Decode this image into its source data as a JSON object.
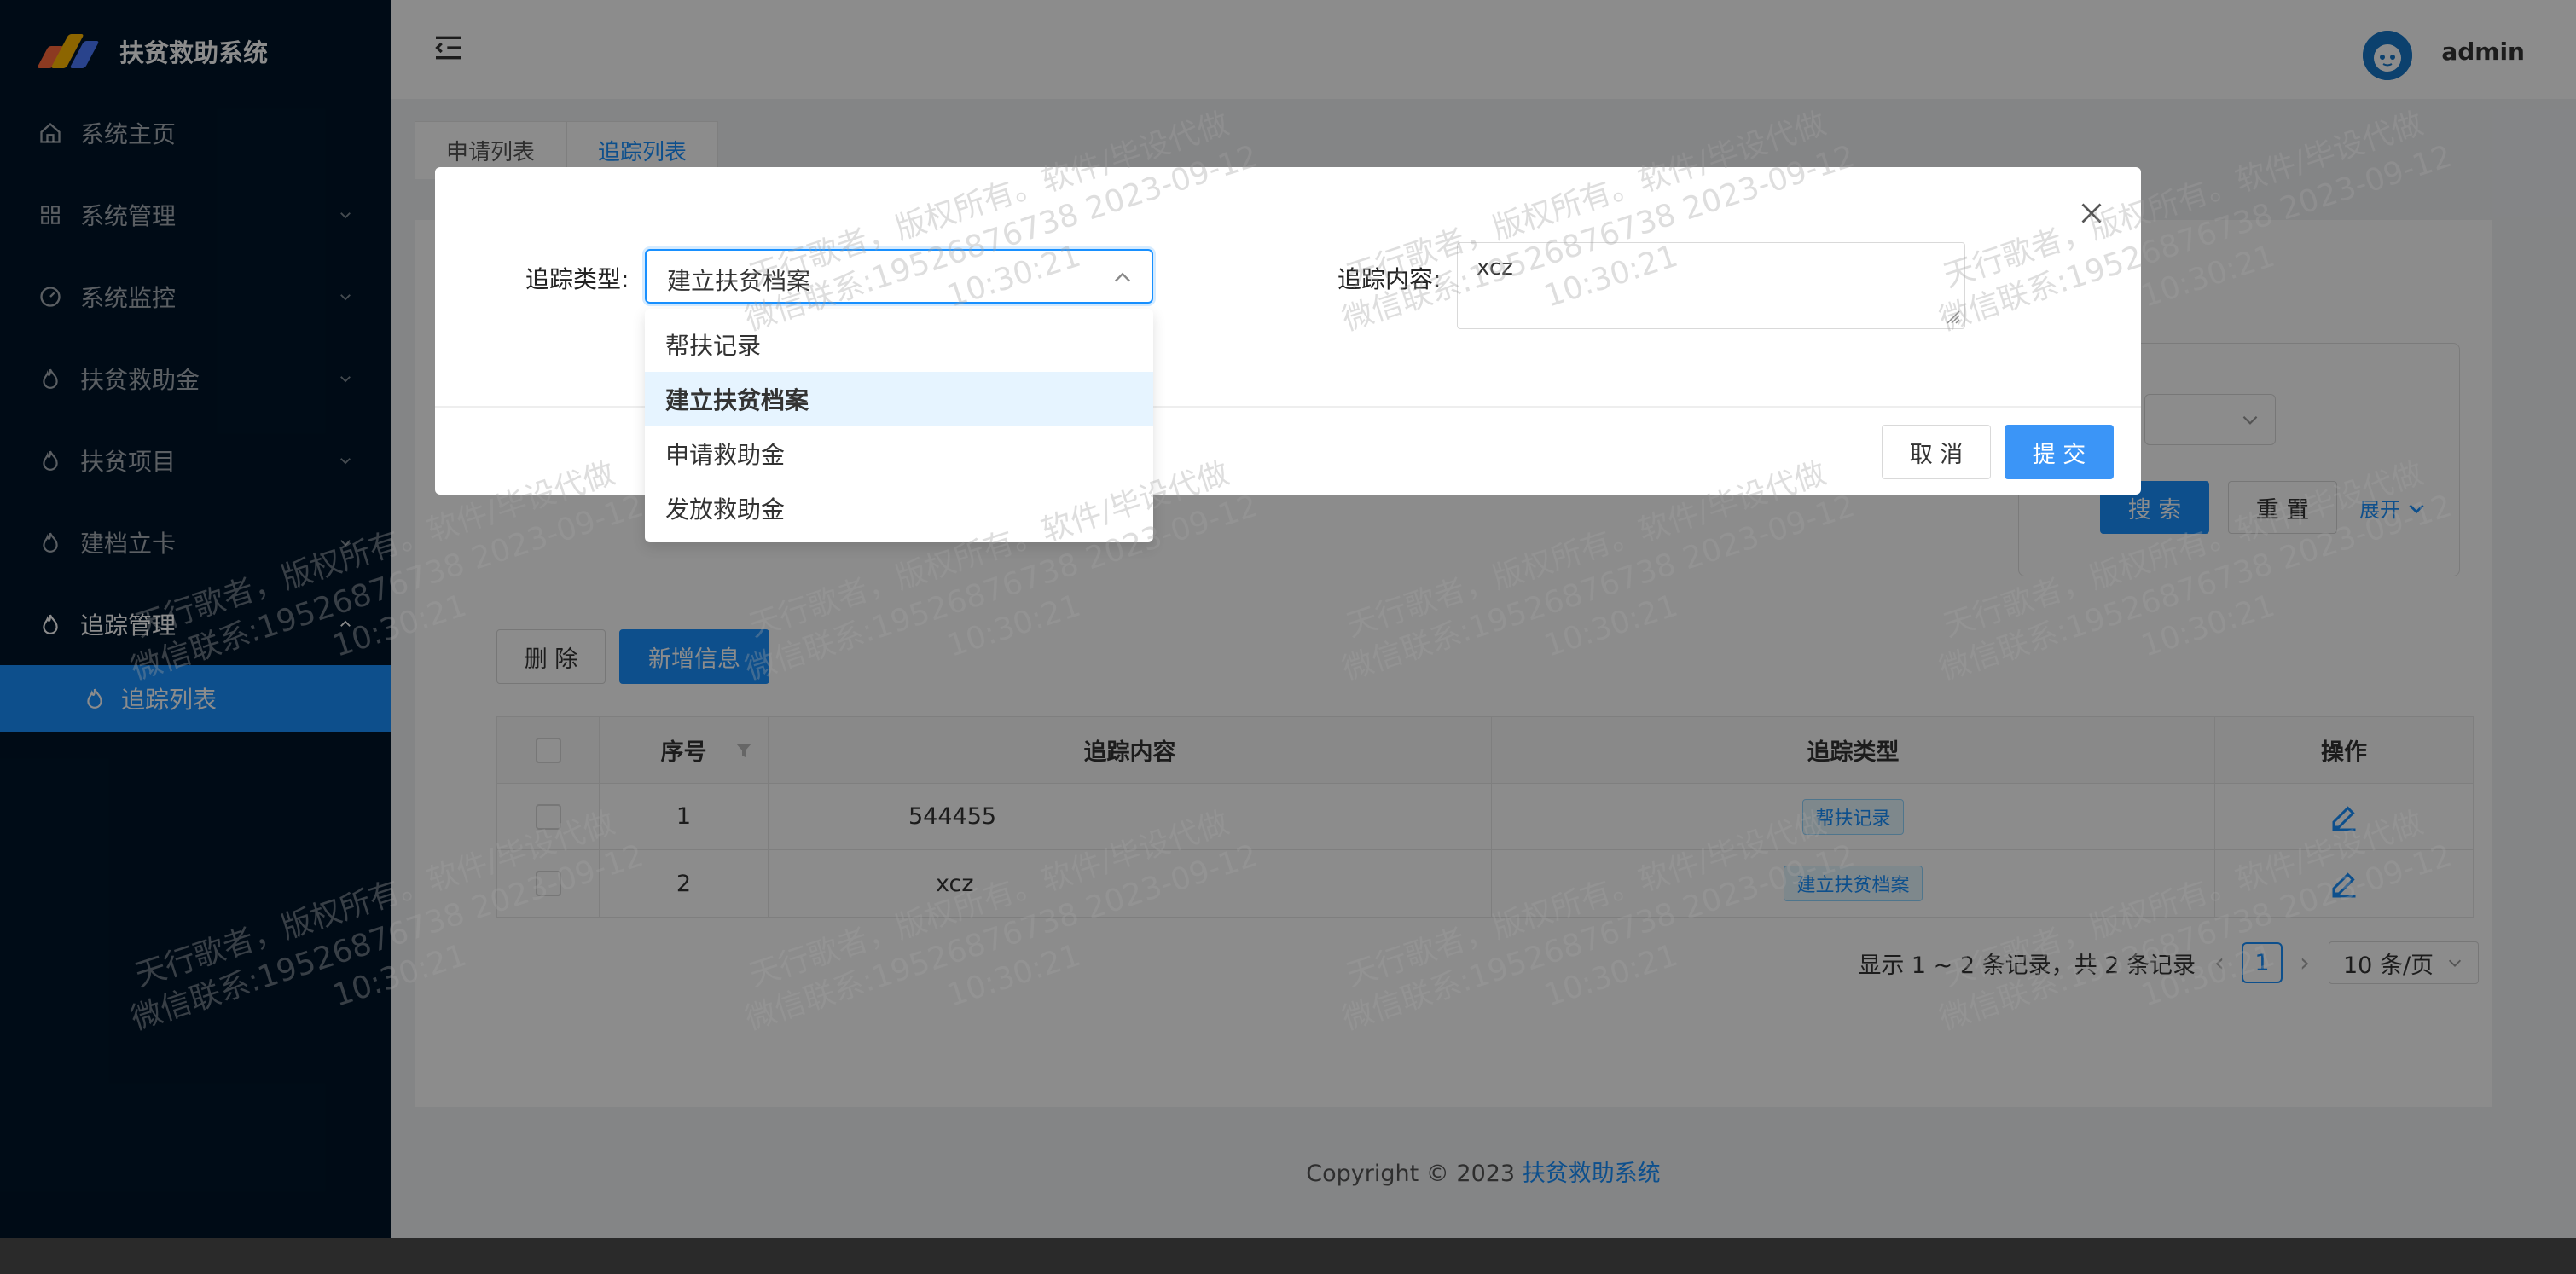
{
  "app": {
    "title": "扶贫救助系统"
  },
  "sidebar": {
    "items": [
      {
        "label": "系统主页",
        "icon": "home-icon",
        "has_arrow": false
      },
      {
        "label": "系统管理",
        "icon": "grid-icon",
        "has_arrow": true
      },
      {
        "label": "系统监控",
        "icon": "dashboard-icon",
        "has_arrow": true
      },
      {
        "label": "扶贫救助金",
        "icon": "fire-icon",
        "has_arrow": true
      },
      {
        "label": "扶贫项目",
        "icon": "fire-icon",
        "has_arrow": true
      },
      {
        "label": "建档立卡",
        "icon": "fire-icon",
        "has_arrow": true
      },
      {
        "label": "追踪管理",
        "icon": "fire-icon",
        "has_arrow": true,
        "open": true
      }
    ],
    "sub_items": [
      {
        "label": "追踪列表",
        "icon": "fire-icon",
        "active": true
      }
    ]
  },
  "header": {
    "username": "admin"
  },
  "tabs": [
    {
      "label": "申请列表"
    },
    {
      "label": "追踪列表",
      "active": true
    }
  ],
  "search": {
    "search_label": "搜 索",
    "reset_label": "重 置",
    "expand_label": "展开"
  },
  "toolbar": {
    "delete_label": "删 除",
    "add_label": "新增信息"
  },
  "table": {
    "headers": [
      "序号",
      "追踪内容",
      "追踪类型",
      "操作"
    ],
    "rows": [
      {
        "index": "1",
        "content": "544455",
        "type": "帮扶记录"
      },
      {
        "index": "2",
        "content": "xcz",
        "type": "建立扶贫档案"
      }
    ]
  },
  "pagination": {
    "summary": "显示 1 ~ 2 条记录，共 2 条记录",
    "current": "1",
    "page_size": "10 条/页"
  },
  "footer": {
    "copyright": "Copyright © 2023 ",
    "brand": "扶贫救助系统"
  },
  "modal": {
    "type_label": "追踪类型:",
    "type_value": "建立扶贫档案",
    "content_label": "追踪内容:",
    "content_value": "xcz",
    "cancel_label": "取 消",
    "submit_label": "提 交",
    "options": [
      "帮扶记录",
      "建立扶贫档案",
      "申请救助金",
      "发放救助金"
    ],
    "selected_option": "建立扶贫档案"
  },
  "watermark": {
    "line1": "天行歌者，版权所有。软件/毕设代做",
    "line2": "微信联系:19526876738 2023-09-12",
    "line3": "10:30:21"
  },
  "colors": {
    "primary": "#1890ff",
    "sidebar_bg": "#001529"
  }
}
